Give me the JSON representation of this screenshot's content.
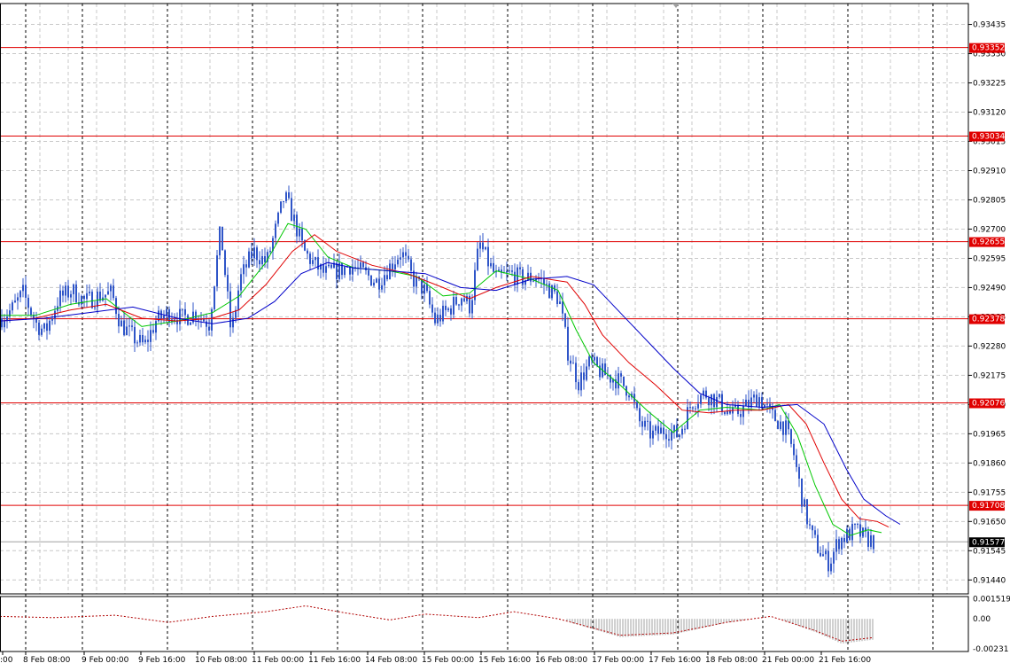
{
  "colors": {
    "background": "#ffffff",
    "grid": "#c8c8c8",
    "candles": "#2f55c8",
    "ma_fast": "#00c800",
    "ma_mid": "#e00000",
    "ma_slow": "#0000c8",
    "levels": "#e00000",
    "osc": "#b00000",
    "osc_hist": "#a0a0a0",
    "price_line": "#a0a0a0"
  },
  "chart_data": {
    "type": "candlestick",
    "price_axis": {
      "range": [
        0.9139,
        0.9351
      ],
      "ticks": [
        "0.93435",
        "0.93330",
        "0.93225",
        "0.93120",
        "0.93015",
        "0.92910",
        "0.92805",
        "0.92700",
        "0.92595",
        "0.92490",
        "0.92385",
        "0.92280",
        "0.92175",
        "0.92070",
        "0.91965",
        "0.91860",
        "0.91755",
        "0.91650",
        "0.91545",
        "0.91440"
      ]
    },
    "time_axis": {
      "labels": [
        ":00",
        "8 Feb 08:00",
        "9 Feb 00:00",
        "9 Feb 16:00",
        "10 Feb 08:00",
        "11 Feb 00:00",
        "11 Feb 16:00",
        "14 Feb 08:00",
        "15 Feb 00:00",
        "15 Feb 16:00",
        "16 Feb 08:00",
        "17 Feb 00:00",
        "17 Feb 16:00",
        "18 Feb 08:00",
        "21 Feb 00:00",
        "21 Feb 16:00"
      ]
    },
    "horizontal_levels": [
      "0.93352",
      "0.93034",
      "0.92655",
      "0.92378",
      "0.92076",
      "0.91708"
    ],
    "current_price": "0.91577",
    "close_path": [
      [
        0,
        0.9238
      ],
      [
        12,
        0.9241
      ],
      [
        25,
        0.9247
      ],
      [
        40,
        0.9236
      ],
      [
        50,
        0.9233
      ],
      [
        65,
        0.9245
      ],
      [
        80,
        0.9248
      ],
      [
        95,
        0.9244
      ],
      [
        110,
        0.9246
      ],
      [
        125,
        0.9247
      ],
      [
        135,
        0.9236
      ],
      [
        150,
        0.9231
      ],
      [
        162,
        0.9228
      ],
      [
        175,
        0.9237
      ],
      [
        190,
        0.924
      ],
      [
        205,
        0.9238
      ],
      [
        220,
        0.924
      ],
      [
        235,
        0.9236
      ],
      [
        248,
        0.927
      ],
      [
        260,
        0.9232
      ],
      [
        270,
        0.9252
      ],
      [
        285,
        0.9262
      ],
      [
        300,
        0.9258
      ],
      [
        312,
        0.9272
      ],
      [
        320,
        0.9282
      ],
      [
        330,
        0.9274
      ],
      [
        342,
        0.9262
      ],
      [
        352,
        0.9258
      ],
      [
        365,
        0.9254
      ],
      [
        380,
        0.9255
      ],
      [
        395,
        0.9257
      ],
      [
        410,
        0.9254
      ],
      [
        425,
        0.9251
      ],
      [
        440,
        0.9257
      ],
      [
        452,
        0.9262
      ],
      [
        465,
        0.9252
      ],
      [
        478,
        0.9248
      ],
      [
        490,
        0.9237
      ],
      [
        505,
        0.9241
      ],
      [
        520,
        0.9246
      ],
      [
        530,
        0.9242
      ],
      [
        540,
        0.9265
      ],
      [
        550,
        0.9258
      ],
      [
        560,
        0.9252
      ],
      [
        575,
        0.9254
      ],
      [
        590,
        0.9252
      ],
      [
        605,
        0.9253
      ],
      [
        620,
        0.9248
      ],
      [
        630,
        0.9245
      ],
      [
        640,
        0.9226
      ],
      [
        652,
        0.9215
      ],
      [
        665,
        0.9222
      ],
      [
        680,
        0.9218
      ],
      [
        695,
        0.9216
      ],
      [
        710,
        0.9212
      ],
      [
        720,
        0.9201
      ],
      [
        735,
        0.9196
      ],
      [
        750,
        0.9198
      ],
      [
        765,
        0.9196
      ],
      [
        780,
        0.9208
      ],
      [
        795,
        0.9211
      ],
      [
        810,
        0.9208
      ],
      [
        825,
        0.9203
      ],
      [
        840,
        0.9206
      ],
      [
        855,
        0.921
      ],
      [
        870,
        0.9203
      ],
      [
        885,
        0.9199
      ],
      [
        895,
        0.9189
      ],
      [
        905,
        0.9172
      ],
      [
        915,
        0.916
      ],
      [
        925,
        0.9154
      ],
      [
        935,
        0.915
      ],
      [
        945,
        0.9158
      ],
      [
        955,
        0.916
      ],
      [
        965,
        0.9162
      ],
      [
        975,
        0.9159
      ],
      [
        985,
        0.9158
      ]
    ],
    "ma_fast": [
      [
        0,
        0.9239
      ],
      [
        40,
        0.9239
      ],
      [
        80,
        0.9243
      ],
      [
        120,
        0.9245
      ],
      [
        160,
        0.9235
      ],
      [
        200,
        0.9237
      ],
      [
        240,
        0.924
      ],
      [
        270,
        0.9246
      ],
      [
        300,
        0.9258
      ],
      [
        325,
        0.9272
      ],
      [
        345,
        0.927
      ],
      [
        370,
        0.926
      ],
      [
        400,
        0.9256
      ],
      [
        440,
        0.9255
      ],
      [
        470,
        0.9253
      ],
      [
        500,
        0.9246
      ],
      [
        530,
        0.9247
      ],
      [
        560,
        0.9255
      ],
      [
        600,
        0.9252
      ],
      [
        630,
        0.9248
      ],
      [
        650,
        0.9234
      ],
      [
        670,
        0.9222
      ],
      [
        700,
        0.9214
      ],
      [
        730,
        0.9205
      ],
      [
        760,
        0.9197
      ],
      [
        790,
        0.9205
      ],
      [
        820,
        0.9206
      ],
      [
        860,
        0.9205
      ],
      [
        880,
        0.9207
      ],
      [
        900,
        0.9196
      ],
      [
        920,
        0.9178
      ],
      [
        940,
        0.9164
      ],
      [
        960,
        0.916
      ],
      [
        980,
        0.9162
      ],
      [
        995,
        0.9161
      ]
    ],
    "ma_mid": [
      [
        0,
        0.9237
      ],
      [
        40,
        0.9238
      ],
      [
        80,
        0.9241
      ],
      [
        120,
        0.9243
      ],
      [
        160,
        0.9238
      ],
      [
        200,
        0.9237
      ],
      [
        240,
        0.9238
      ],
      [
        270,
        0.9241
      ],
      [
        300,
        0.925
      ],
      [
        330,
        0.9262
      ],
      [
        355,
        0.9268
      ],
      [
        380,
        0.9262
      ],
      [
        420,
        0.9257
      ],
      [
        460,
        0.9254
      ],
      [
        500,
        0.9249
      ],
      [
        530,
        0.9245
      ],
      [
        560,
        0.9249
      ],
      [
        600,
        0.9253
      ],
      [
        640,
        0.9251
      ],
      [
        660,
        0.9243
      ],
      [
        680,
        0.9232
      ],
      [
        710,
        0.9222
      ],
      [
        740,
        0.9214
      ],
      [
        770,
        0.9205
      ],
      [
        800,
        0.9204
      ],
      [
        830,
        0.9205
      ],
      [
        860,
        0.9205
      ],
      [
        890,
        0.9207
      ],
      [
        910,
        0.92
      ],
      [
        930,
        0.9186
      ],
      [
        950,
        0.9173
      ],
      [
        970,
        0.9166
      ],
      [
        990,
        0.9165
      ],
      [
        1003,
        0.9163
      ]
    ],
    "ma_slow": [
      [
        0,
        0.9237
      ],
      [
        50,
        0.9238
      ],
      [
        100,
        0.924
      ],
      [
        150,
        0.9242
      ],
      [
        200,
        0.9238
      ],
      [
        240,
        0.9236
      ],
      [
        280,
        0.9238
      ],
      [
        310,
        0.9244
      ],
      [
        340,
        0.9254
      ],
      [
        370,
        0.9258
      ],
      [
        400,
        0.9256
      ],
      [
        440,
        0.9255
      ],
      [
        480,
        0.9254
      ],
      [
        520,
        0.9249
      ],
      [
        560,
        0.9248
      ],
      [
        600,
        0.9252
      ],
      [
        640,
        0.9253
      ],
      [
        670,
        0.925
      ],
      [
        700,
        0.924
      ],
      [
        730,
        0.923
      ],
      [
        760,
        0.922
      ],
      [
        790,
        0.9211
      ],
      [
        820,
        0.9207
      ],
      [
        860,
        0.9206
      ],
      [
        900,
        0.9207
      ],
      [
        930,
        0.92
      ],
      [
        955,
        0.9184
      ],
      [
        975,
        0.9173
      ],
      [
        1000,
        0.9167
      ],
      [
        1016,
        0.9164
      ]
    ],
    "oscillator": {
      "ticks": [
        "0.001519",
        "0.00",
        "-0.00231"
      ],
      "range": [
        -0.0025,
        0.0017
      ]
    }
  }
}
